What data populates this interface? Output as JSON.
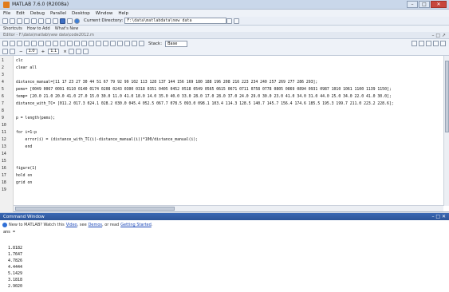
{
  "window": {
    "title": "MATLAB 7.6.0 (R2008a)",
    "minimize": "–",
    "maximize": "□",
    "close": "✕"
  },
  "menu": [
    "File",
    "Edit",
    "Debug",
    "Parallel",
    "Desktop",
    "Window",
    "Help"
  ],
  "toolbar": {
    "current_dir_label": "Current Directory:",
    "current_dir_value": "F:\\data\\matlabdata\\new data"
  },
  "shortcuts": [
    "Shortcuts",
    "How to Add",
    "What's New"
  ],
  "editor": {
    "title": "Editor - F:\\data\\matlab\\new data\\code2012.m",
    "stack_label": "Stack:",
    "stack_value": "Base",
    "cell_minus": "1.0",
    "cell_plus": "1.1",
    "lines": [
      {
        "n": "1",
        "text": "clc"
      },
      {
        "n": "2",
        "text": "clear all"
      },
      {
        "n": "3",
        "text": ""
      },
      {
        "n": "4",
        "text": "distance_manual=[11 17 23 27 30 44 51 67 79 92 99 102 113 128 137 144 156 169 180 188 196 208 216 223 234 240 257 269 277 286 293];"
      },
      {
        "n": "5",
        "text": "pems= [0049 0067 0091 0110 0140 0174 0208 0243 0300 0318 0351 0405 0452 0518 0549 0565 0615 0671 0711 0758 0778 0805 0869 0894 0931 0987 1010 1061 1100 1139 1150];"
      },
      {
        "n": "6",
        "text": "temp= [20.0 21.0 20.0 41.0 27.0 15.0 30.0 11.0 41.0 18.0 14.0 35.0 40.0 33.0 28.0 17.0 28.0 37.0 24.0 29.0 30.0 23.0 41.0 34.0 31.0 44.0 25.0 34.0 22.0 41.0 30.0];"
      },
      {
        "n": "7",
        "text": "distance_with_TC= [011.2 017.3 024.1 028.2 030.0 045.4 052.5 067.7 078.5 093.0 098.1 103.4 114.3 128.5 140.7 145.7 156.4 174.6 185.5 195.3 199.7 211.0 223.2 228.6];"
      },
      {
        "n": "8",
        "text": ""
      },
      {
        "n": "9",
        "text": "p = length(pems);"
      },
      {
        "n": "10",
        "text": ""
      },
      {
        "n": "11",
        "text": "for i=1:p"
      },
      {
        "n": "12",
        "text": "    error(i) = (distance_with_TC(i)-distance_manual(i))*100/distance_manual(i);"
      },
      {
        "n": "13",
        "text": "    end"
      },
      {
        "n": "14",
        "text": ""
      },
      {
        "n": "15",
        "text": ""
      },
      {
        "n": "16",
        "text": "figure(1)"
      },
      {
        "n": "17",
        "text": "hold on"
      },
      {
        "n": "18",
        "text": "grid on"
      },
      {
        "n": "19",
        "text": ""
      }
    ]
  },
  "command_window": {
    "title": "Command Window",
    "info_prefix": "New to MATLAB? Watch this",
    "video_link": "Video",
    "info_middle": ", see",
    "demos_link": "Demos",
    "info_after_demos": ", or read",
    "getting_started_link": "Getting Started",
    "info_end": ".",
    "prompt_line": "ans =",
    "values": [
      "1.8182",
      "1.7647",
      "4.7826",
      "4.4444",
      "5.1429",
      "3.1818",
      "2.9020"
    ]
  }
}
